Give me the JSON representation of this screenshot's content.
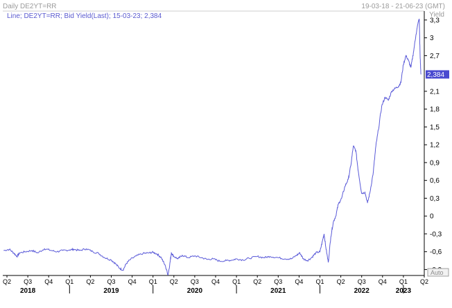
{
  "header": {
    "title": "Daily DE2YT=RR",
    "range": "19-03-18 - 21-06-23 (GMT)",
    "unit": "Yield"
  },
  "legend": {
    "text": "Line; DE2YT=RR; Bid Yield(Last); 15-03-23; 2,384"
  },
  "last_value_label": "2,384",
  "auto_label": "Auto",
  "colors": {
    "line": "#5a5ad8",
    "last_bg": "#4a4ad0",
    "axis": "#000000",
    "header": "#9a9a9a"
  },
  "chart_data": {
    "type": "line",
    "title": "Daily DE2YT=RR",
    "ylabel": "Yield",
    "ylim": [
      -1.0,
      3.45
    ],
    "grid": false,
    "y_ticks": [
      {
        "value": 3.3,
        "label": "3,3"
      },
      {
        "value": 3.0,
        "label": "3"
      },
      {
        "value": 2.7,
        "label": "2,7"
      },
      {
        "value": 2.1,
        "label": "2,1"
      },
      {
        "value": 1.8,
        "label": "1,8"
      },
      {
        "value": 1.5,
        "label": "1,5"
      },
      {
        "value": 1.2,
        "label": "1,2"
      },
      {
        "value": 0.9,
        "label": "0,9"
      },
      {
        "value": 0.6,
        "label": "0,6"
      },
      {
        "value": 0.3,
        "label": "0,3"
      },
      {
        "value": 0.0,
        "label": "0"
      },
      {
        "value": -0.3,
        "label": "-0,3"
      },
      {
        "value": -0.6,
        "label": "-0,6"
      },
      {
        "value": -0.9,
        "label": "-0,9"
      }
    ],
    "x_range": [
      2018.2,
      2023.25
    ],
    "quarter_ticks": [
      {
        "t": 2018.25,
        "label": "Q2"
      },
      {
        "t": 2018.5,
        "label": "Q3"
      },
      {
        "t": 2018.75,
        "label": "Q4"
      },
      {
        "t": 2019.0,
        "label": "Q1"
      },
      {
        "t": 2019.25,
        "label": "Q2"
      },
      {
        "t": 2019.5,
        "label": "Q3"
      },
      {
        "t": 2019.75,
        "label": "Q4"
      },
      {
        "t": 2020.0,
        "label": "Q1"
      },
      {
        "t": 2020.25,
        "label": "Q2"
      },
      {
        "t": 2020.5,
        "label": "Q3"
      },
      {
        "t": 2020.75,
        "label": "Q4"
      },
      {
        "t": 2021.0,
        "label": "Q1"
      },
      {
        "t": 2021.25,
        "label": "Q2"
      },
      {
        "t": 2021.5,
        "label": "Q3"
      },
      {
        "t": 2021.75,
        "label": "Q4"
      },
      {
        "t": 2022.0,
        "label": "Q1"
      },
      {
        "t": 2022.25,
        "label": "Q2"
      },
      {
        "t": 2022.5,
        "label": "Q3"
      },
      {
        "t": 2022.75,
        "label": "Q4"
      },
      {
        "t": 2023.0,
        "label": "Q1"
      },
      {
        "t": 2023.25,
        "label": "Q2"
      }
    ],
    "year_labels": [
      {
        "t": 2018.5,
        "label": "2018"
      },
      {
        "t": 2019.5,
        "label": "2019"
      },
      {
        "t": 2020.5,
        "label": "2020"
      },
      {
        "t": 2021.5,
        "label": "2021"
      },
      {
        "t": 2022.5,
        "label": "2022"
      },
      {
        "t": 2023.0,
        "label": "2023"
      }
    ],
    "last_value": 2.384,
    "series": [
      {
        "values": [
          [
            2018.21,
            -0.58
          ],
          [
            2018.28,
            -0.56
          ],
          [
            2018.33,
            -0.62
          ],
          [
            2018.37,
            -0.68
          ],
          [
            2018.4,
            -0.62
          ],
          [
            2018.47,
            -0.6
          ],
          [
            2018.55,
            -0.58
          ],
          [
            2018.62,
            -0.62
          ],
          [
            2018.7,
            -0.55
          ],
          [
            2018.78,
            -0.58
          ],
          [
            2018.85,
            -0.6
          ],
          [
            2018.92,
            -0.58
          ],
          [
            2019.0,
            -0.57
          ],
          [
            2019.05,
            -0.56
          ],
          [
            2019.12,
            -0.58
          ],
          [
            2019.2,
            -0.55
          ],
          [
            2019.28,
            -0.6
          ],
          [
            2019.35,
            -0.63
          ],
          [
            2019.42,
            -0.7
          ],
          [
            2019.5,
            -0.74
          ],
          [
            2019.55,
            -0.8
          ],
          [
            2019.6,
            -0.88
          ],
          [
            2019.64,
            -0.91
          ],
          [
            2019.68,
            -0.8
          ],
          [
            2019.72,
            -0.74
          ],
          [
            2019.8,
            -0.67
          ],
          [
            2019.88,
            -0.63
          ],
          [
            2019.95,
            -0.62
          ],
          [
            2020.0,
            -0.61
          ],
          [
            2020.05,
            -0.64
          ],
          [
            2020.1,
            -0.7
          ],
          [
            2020.15,
            -0.85
          ],
          [
            2020.18,
            -0.99
          ],
          [
            2020.2,
            -0.82
          ],
          [
            2020.22,
            -0.62
          ],
          [
            2020.25,
            -0.68
          ],
          [
            2020.3,
            -0.72
          ],
          [
            2020.35,
            -0.66
          ],
          [
            2020.42,
            -0.7
          ],
          [
            2020.5,
            -0.67
          ],
          [
            2020.58,
            -0.7
          ],
          [
            2020.65,
            -0.73
          ],
          [
            2020.72,
            -0.72
          ],
          [
            2020.8,
            -0.76
          ],
          [
            2020.88,
            -0.75
          ],
          [
            2020.95,
            -0.74
          ],
          [
            2021.0,
            -0.72
          ],
          [
            2021.08,
            -0.74
          ],
          [
            2021.15,
            -0.71
          ],
          [
            2021.25,
            -0.68
          ],
          [
            2021.33,
            -0.7
          ],
          [
            2021.4,
            -0.68
          ],
          [
            2021.5,
            -0.7
          ],
          [
            2021.58,
            -0.72
          ],
          [
            2021.66,
            -0.72
          ],
          [
            2021.72,
            -0.66
          ],
          [
            2021.76,
            -0.62
          ],
          [
            2021.8,
            -0.72
          ],
          [
            2021.85,
            -0.75
          ],
          [
            2021.9,
            -0.7
          ],
          [
            2021.95,
            -0.62
          ],
          [
            2022.0,
            -0.6
          ],
          [
            2022.03,
            -0.42
          ],
          [
            2022.05,
            -0.3
          ],
          [
            2022.07,
            -0.52
          ],
          [
            2022.1,
            -0.78
          ],
          [
            2022.13,
            -0.35
          ],
          [
            2022.16,
            -0.1
          ],
          [
            2022.19,
            0.0
          ],
          [
            2022.22,
            0.2
          ],
          [
            2022.26,
            0.3
          ],
          [
            2022.3,
            0.5
          ],
          [
            2022.34,
            0.62
          ],
          [
            2022.37,
            0.85
          ],
          [
            2022.4,
            1.18
          ],
          [
            2022.43,
            1.1
          ],
          [
            2022.46,
            0.75
          ],
          [
            2022.5,
            0.38
          ],
          [
            2022.54,
            0.4
          ],
          [
            2022.57,
            0.22
          ],
          [
            2022.6,
            0.4
          ],
          [
            2022.64,
            0.75
          ],
          [
            2022.67,
            1.18
          ],
          [
            2022.7,
            1.45
          ],
          [
            2022.74,
            1.85
          ],
          [
            2022.78,
            2.0
          ],
          [
            2022.82,
            1.95
          ],
          [
            2022.86,
            2.1
          ],
          [
            2022.9,
            2.15
          ],
          [
            2022.94,
            2.18
          ],
          [
            2022.97,
            2.25
          ],
          [
            2023.0,
            2.55
          ],
          [
            2023.03,
            2.7
          ],
          [
            2023.06,
            2.62
          ],
          [
            2023.09,
            2.5
          ],
          [
            2023.12,
            2.75
          ],
          [
            2023.15,
            3.05
          ],
          [
            2023.18,
            3.28
          ],
          [
            2023.19,
            3.32
          ],
          [
            2023.2,
            2.7
          ],
          [
            2023.21,
            2.384
          ]
        ]
      }
    ]
  }
}
